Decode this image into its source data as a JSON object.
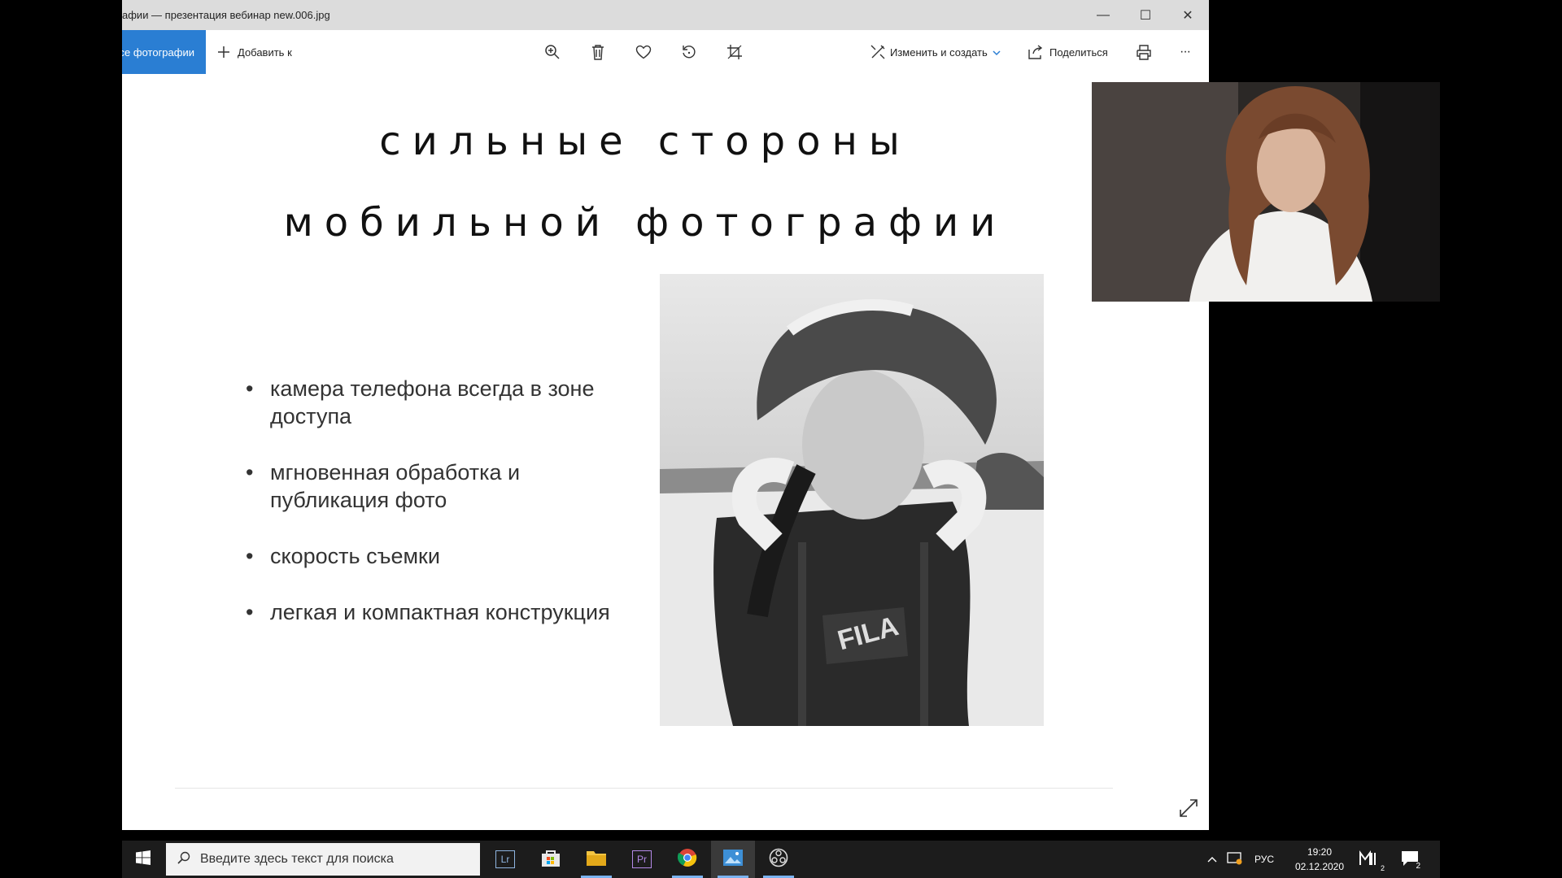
{
  "window": {
    "title": "афии — презентация вебинар new.006.jpg",
    "minimize_glyph": "—",
    "maximize_glyph": "☐",
    "close_glyph": "✕"
  },
  "toolbar": {
    "all_photos_label": "се фотографии",
    "add_to_label": "Добавить к",
    "edit_create_label": "Изменить и создать",
    "share_label": "Поделиться",
    "more_label": "···",
    "icons": [
      "zoom-in-icon",
      "delete-icon",
      "heart-icon",
      "rotate-icon",
      "crop-icon",
      "edit-icon",
      "share-icon",
      "print-icon"
    ]
  },
  "slide": {
    "title_line1": "сильные стороны",
    "title_line2": "мобильной фотографии",
    "bullets": [
      "камера телефона всегда в зоне доступа",
      "мгновенная обработка и публикация фото",
      "скорость съемки",
      "легкая и компактная конструкция"
    ]
  },
  "taskbar": {
    "search_placeholder": "Введите здесь текст для поиска",
    "apps": [
      "lightroom",
      "store",
      "file-explorer",
      "premiere",
      "chrome",
      "photos",
      "obs"
    ],
    "lightroom_text": "Lr",
    "premiere_text": "Pr",
    "language": "РУС",
    "time": "19:20",
    "date": "02.12.2020",
    "notification_count": "2",
    "tray_badge": "2"
  }
}
